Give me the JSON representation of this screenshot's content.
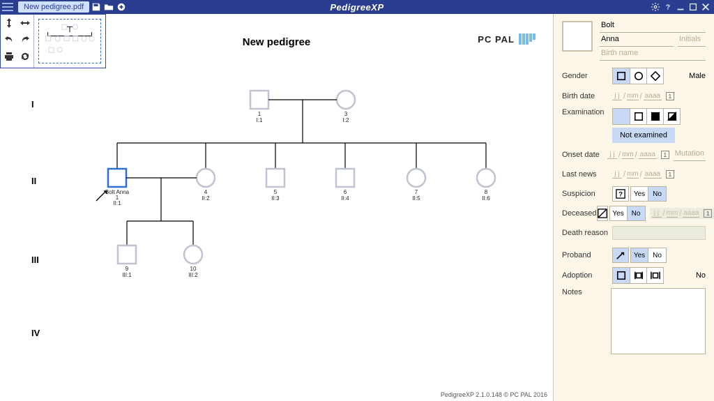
{
  "titlebar": {
    "filename": "New pedigree.pdf",
    "app_name": "PedigreeXP"
  },
  "canvas": {
    "title": "New pedigree",
    "brand": "PC PAL",
    "footer": "PedigreeXP 2.1.0.148 © PC PAL 2016",
    "generations": {
      "g1": "I",
      "g2": "II",
      "g3": "III",
      "g4": "IV"
    },
    "nodes": {
      "i1": {
        "num": "1",
        "id": "I:1"
      },
      "i2": {
        "num": "3",
        "id": "I:2"
      },
      "ii1": {
        "name": "Bolt Anna",
        "num": "1",
        "id": "II:1"
      },
      "ii2": {
        "num": "4",
        "id": "II:2"
      },
      "ii3": {
        "num": "5",
        "id": "II:3"
      },
      "ii4": {
        "num": "6",
        "id": "II:4"
      },
      "ii5": {
        "num": "7",
        "id": "II:5"
      },
      "ii6": {
        "num": "8",
        "id": "II:6"
      },
      "iii1": {
        "num": "9",
        "id": "III:1"
      },
      "iii2": {
        "num": "10",
        "id": "III:2"
      }
    }
  },
  "panel": {
    "surname": "Bolt",
    "given": "Anna",
    "initials_ph": "Initials",
    "birthname_ph": "Birth name",
    "labels": {
      "gender": "Gender",
      "birth": "Birth date",
      "exam": "Examination",
      "onset": "Onset date",
      "lastnews": "Last news",
      "suspicion": "Suspicion",
      "deceased": "Deceased",
      "deathreason": "Death reason",
      "proband": "Proband",
      "adoption": "Adoption",
      "notes": "Notes"
    },
    "gender_value": "Male",
    "exam_status": "Not examined",
    "mutation_ph": "Mutation",
    "yes": "Yes",
    "no": "No",
    "adoption_value": "No",
    "date_parts": {
      "d": "j j",
      "m": "mm",
      "y": "aaaa",
      "sep": "/"
    },
    "cal": "1"
  }
}
